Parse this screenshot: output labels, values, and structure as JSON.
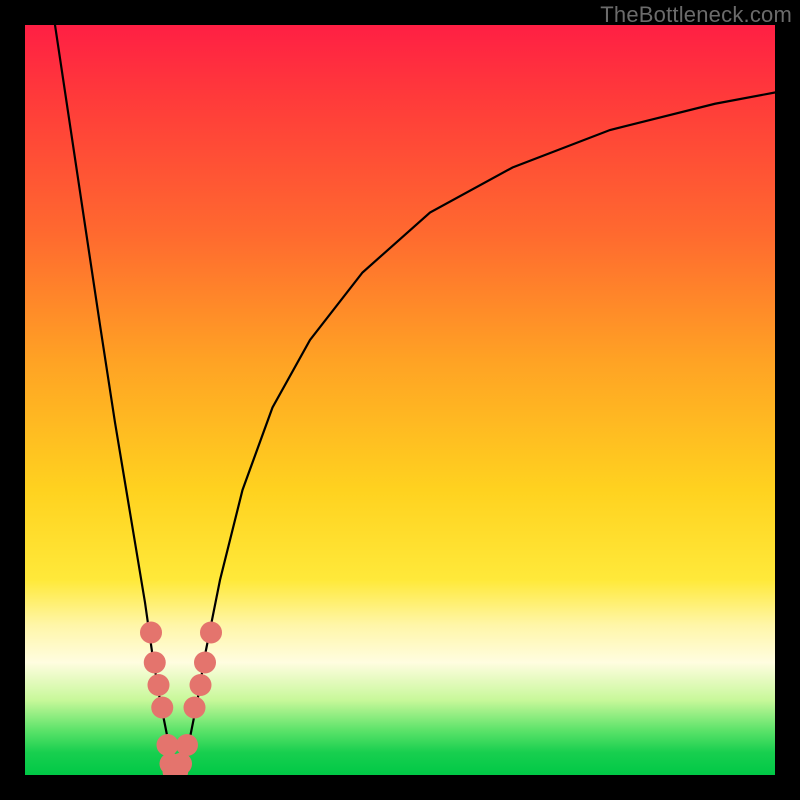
{
  "watermark": "TheBottleneck.com",
  "chart_data": {
    "type": "line",
    "title": "",
    "xlabel": "",
    "ylabel": "",
    "xlim": [
      0,
      100
    ],
    "ylim": [
      0,
      100
    ],
    "grid": false,
    "series": [
      {
        "name": "curve",
        "x": [
          4,
          7,
          10,
          12,
          14,
          16,
          17,
          18,
          19,
          19.5,
          20,
          21,
          22,
          23,
          24,
          26,
          29,
          33,
          38,
          45,
          54,
          65,
          78,
          92,
          100
        ],
        "y": [
          100,
          80,
          60,
          47,
          35,
          23,
          16,
          10,
          5,
          2,
          0.5,
          2,
          5,
          10,
          16,
          26,
          38,
          49,
          58,
          67,
          75,
          81,
          86,
          89.5,
          91
        ]
      }
    ],
    "markers": [
      {
        "x": 16.8,
        "y": 19
      },
      {
        "x": 17.3,
        "y": 15
      },
      {
        "x": 17.8,
        "y": 12
      },
      {
        "x": 18.3,
        "y": 9
      },
      {
        "x": 19.0,
        "y": 4
      },
      {
        "x": 19.4,
        "y": 1.5
      },
      {
        "x": 19.8,
        "y": 0.5
      },
      {
        "x": 20.3,
        "y": 0.5
      },
      {
        "x": 20.8,
        "y": 1.5
      },
      {
        "x": 21.6,
        "y": 4
      },
      {
        "x": 22.6,
        "y": 9
      },
      {
        "x": 23.4,
        "y": 12
      },
      {
        "x": 24.0,
        "y": 15
      },
      {
        "x": 24.8,
        "y": 19
      }
    ],
    "marker_style": {
      "color": "#e4746d",
      "radius_px": 11
    }
  }
}
